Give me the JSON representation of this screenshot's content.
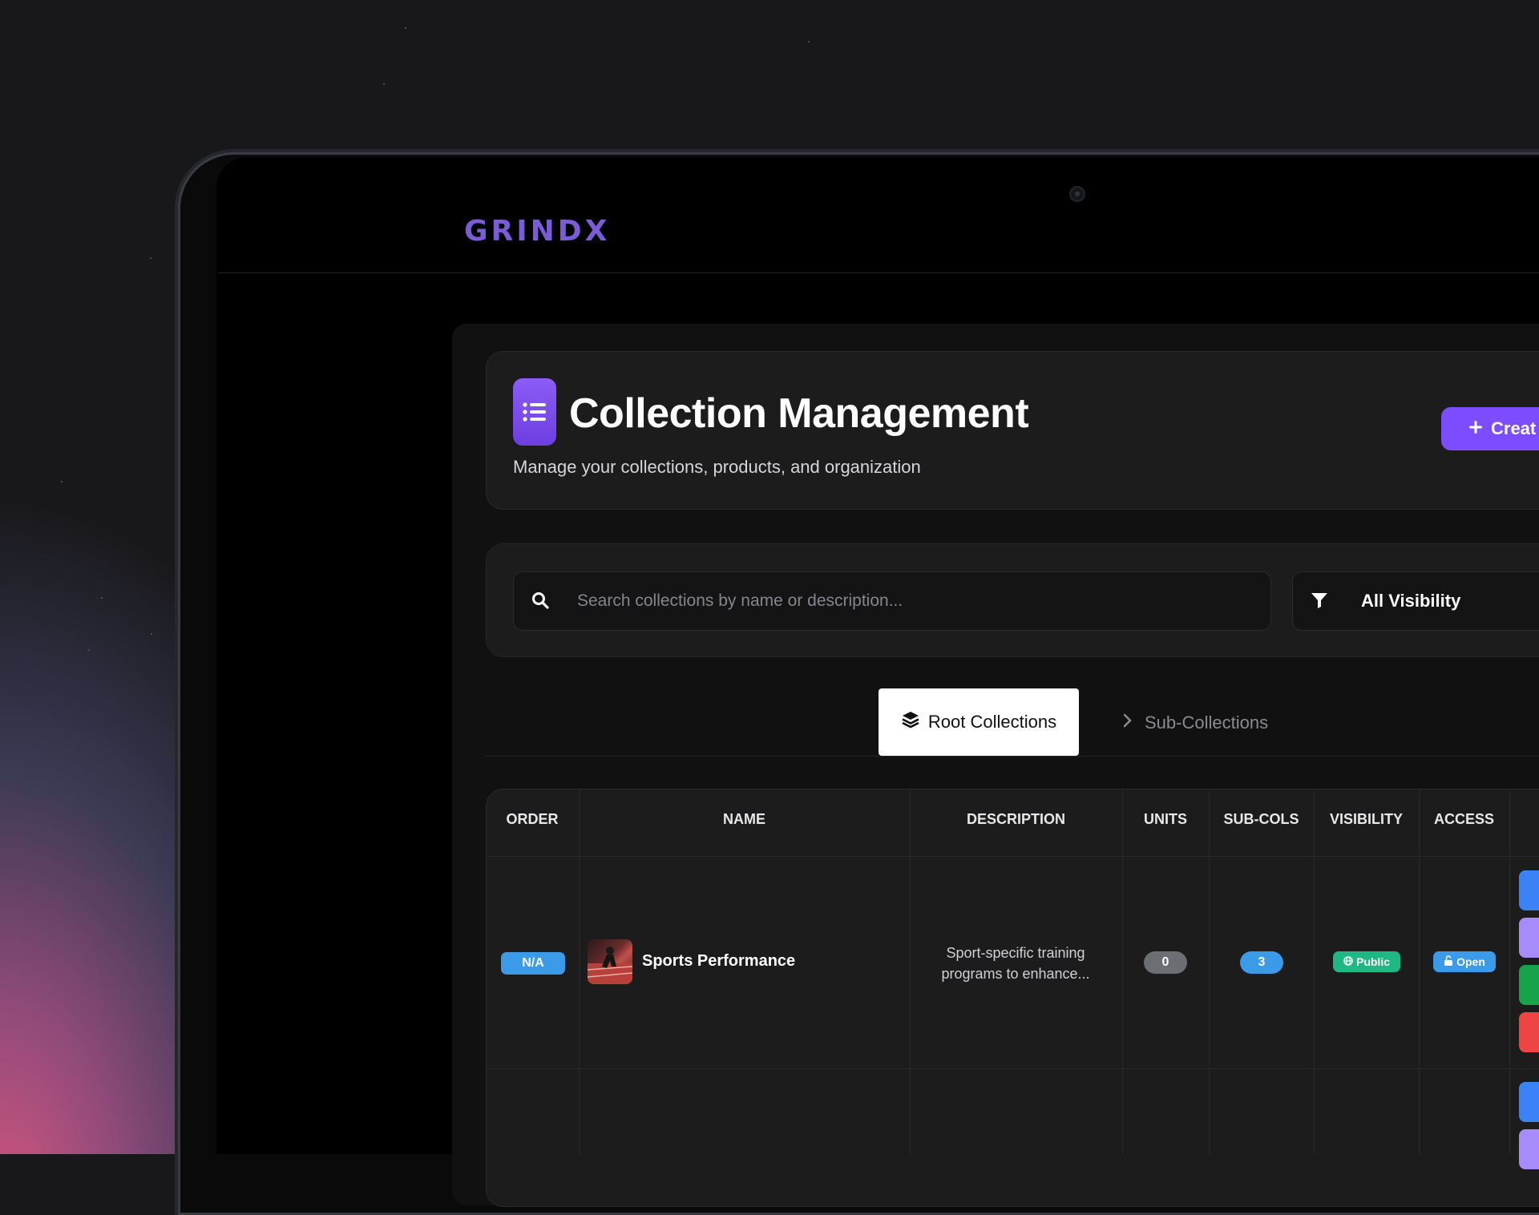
{
  "brand": {
    "logo_text": "GRINDX"
  },
  "header": {
    "title": "Collection Management",
    "subtitle": "Manage your collections, products, and organization",
    "create_button_label": "Creat"
  },
  "filters": {
    "search_placeholder": "Search collections by name or description...",
    "visibility_selected": "All Visibility"
  },
  "tabs": [
    {
      "label": "Root Collections",
      "active": true,
      "icon": "layers-icon"
    },
    {
      "label": "Sub-Collections",
      "active": false,
      "icon": "chevron-right-icon"
    }
  ],
  "table": {
    "columns": [
      "ORDER",
      "NAME",
      "DESCRIPTION",
      "UNITS",
      "SUB-COLS",
      "VISIBILITY",
      "ACCESS"
    ],
    "rows": [
      {
        "order": "N/A",
        "name": "Sports Performance",
        "description": "Sport-specific training programs to enhance...",
        "units": "0",
        "sub_cols": "3",
        "visibility": "Public",
        "access": "Open"
      }
    ]
  },
  "colors": {
    "accent": "#7c4dff",
    "order_badge": "#3b9be8",
    "units_badge": "#6b6f74",
    "subcols_badge": "#3b9be8",
    "public_badge": "#1fb783",
    "open_badge": "#3b9be8",
    "action_colors": [
      "#3b82f6",
      "#a78bfa",
      "#16a34a",
      "#ef4444"
    ]
  }
}
